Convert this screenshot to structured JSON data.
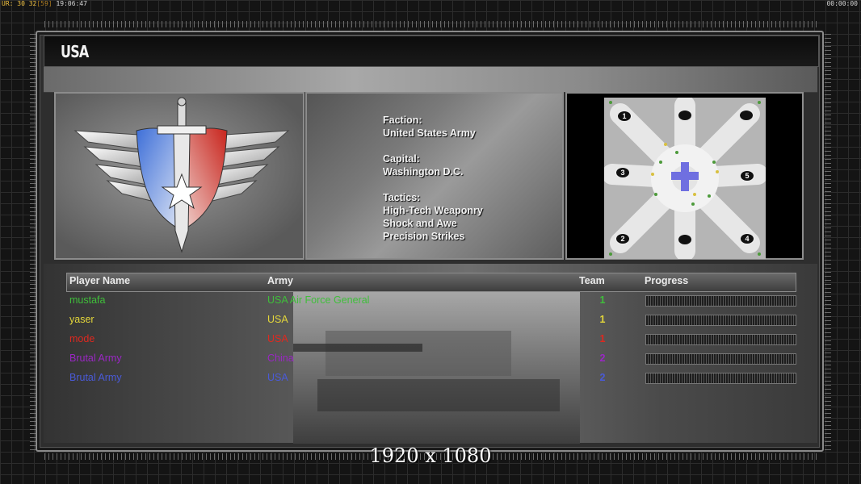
{
  "hud": {
    "left_prefix": "UR: 30 32",
    "left_bracket": "[59]",
    "left_time": "19:06:47",
    "right_time": "00:00:00"
  },
  "screen": {
    "title": "USA"
  },
  "faction_info": {
    "faction_label": "Faction:",
    "faction_value": "United States Army",
    "capital_label": "Capital:",
    "capital_value": "Washington D.C.",
    "tactics_label": "Tactics:",
    "tactics": [
      "High-Tech Weaponry",
      "Shock and Awe",
      "Precision Strikes"
    ]
  },
  "map": {
    "start_positions": [
      "1",
      "3",
      "5",
      "2",
      "4"
    ]
  },
  "players_table": {
    "headers": {
      "player": "Player Name",
      "army": "Army",
      "team": "Team",
      "progress": "Progress"
    },
    "rows": [
      {
        "name": "mustafa",
        "army": "USA Air Force General",
        "team": "1",
        "color": "#3fbf3a",
        "progress": 0
      },
      {
        "name": "yaser",
        "army": "USA",
        "team": "1",
        "color": "#e3d63a",
        "progress": 0
      },
      {
        "name": "mode",
        "army": "USA",
        "team": "1",
        "color": "#e0281f",
        "progress": 0
      },
      {
        "name": "Brutal Army",
        "army": "China",
        "team": "2",
        "color": "#9a27c4",
        "progress": 0
      },
      {
        "name": "Brutal Army",
        "army": "USA",
        "team": "2",
        "color": "#4a5ad8",
        "progress": 0
      }
    ]
  },
  "resolution_label": "1920 x 1080"
}
